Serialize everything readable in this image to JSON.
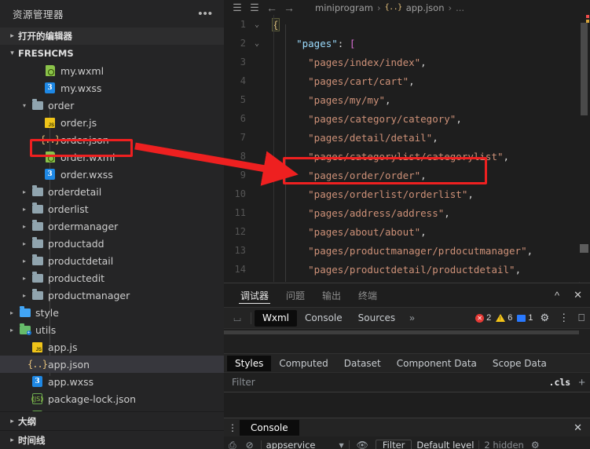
{
  "sidebar": {
    "title": "资源管理器",
    "more_icon": "ellipsis-icon",
    "open_editors": "打开的编辑器",
    "project": "FRESHCMS",
    "tree": [
      {
        "label": "my.wxml",
        "icon": "wxml-file-icon",
        "depth": 3,
        "twisty": "",
        "selected": false
      },
      {
        "label": "my.wxss",
        "icon": "wxss-file-icon",
        "depth": 3,
        "twisty": "",
        "selected": false
      },
      {
        "label": "order",
        "icon": "folder-open-icon",
        "depth": 2,
        "twisty": "▾",
        "selected": false
      },
      {
        "label": "order.js",
        "icon": "js-file-icon",
        "depth": 3,
        "twisty": "",
        "selected": false
      },
      {
        "label": "order.json",
        "icon": "json-file-icon",
        "depth": 3,
        "twisty": "",
        "selected": false
      },
      {
        "label": "order.wxml",
        "icon": "wxml-file-icon",
        "depth": 3,
        "twisty": "",
        "selected": false
      },
      {
        "label": "order.wxss",
        "icon": "wxss-file-icon",
        "depth": 3,
        "twisty": "",
        "selected": false
      },
      {
        "label": "orderdetail",
        "icon": "folder-icon",
        "depth": 2,
        "twisty": "▸",
        "selected": false
      },
      {
        "label": "orderlist",
        "icon": "folder-icon",
        "depth": 2,
        "twisty": "▸",
        "selected": false
      },
      {
        "label": "ordermanager",
        "icon": "folder-icon",
        "depth": 2,
        "twisty": "▸",
        "selected": false
      },
      {
        "label": "productadd",
        "icon": "folder-icon",
        "depth": 2,
        "twisty": "▸",
        "selected": false
      },
      {
        "label": "productdetail",
        "icon": "folder-icon",
        "depth": 2,
        "twisty": "▸",
        "selected": false
      },
      {
        "label": "productedit",
        "icon": "folder-icon",
        "depth": 2,
        "twisty": "▸",
        "selected": false
      },
      {
        "label": "productmanager",
        "icon": "folder-icon",
        "depth": 2,
        "twisty": "▸",
        "selected": false
      },
      {
        "label": "style",
        "icon": "folder-blue-icon",
        "depth": 1,
        "twisty": "▸",
        "selected": false
      },
      {
        "label": "utils",
        "icon": "folder-green-icon",
        "depth": 1,
        "twisty": "▸",
        "selected": false
      },
      {
        "label": "app.js",
        "icon": "js-file-icon",
        "depth": 2,
        "twisty": "",
        "selected": false
      },
      {
        "label": "app.json",
        "icon": "json-file-icon",
        "depth": 2,
        "twisty": "",
        "selected": true
      },
      {
        "label": "app.wxss",
        "icon": "wxss-file-icon",
        "depth": 2,
        "twisty": "",
        "selected": false
      },
      {
        "label": "package-lock.json",
        "icon": "node-file-icon",
        "depth": 2,
        "twisty": "",
        "selected": false
      },
      {
        "label": "package.json",
        "icon": "node-file-icon",
        "depth": 2,
        "twisty": "",
        "selected": false
      }
    ],
    "outline": "大纲",
    "timeline": "时间线"
  },
  "editor": {
    "toolbar_icons": [
      "list-icon",
      "bookmark-icon",
      "arrow-left-icon",
      "arrow-right-icon"
    ],
    "breadcrumb": {
      "root": "miniprogram",
      "file": "app.json",
      "tail": "...",
      "sep": "›"
    },
    "lines": [
      {
        "n": "1",
        "fold": "⌄",
        "html": "<span class=\"c-brace\">{</span>"
      },
      {
        "n": "2",
        "fold": "⌄",
        "html": "    <span class=\"c-key\">\"pages\"</span><span class=\"c-punct\">:</span> <span class=\"c-brk\">[</span>"
      },
      {
        "n": "3",
        "fold": "",
        "html": "      <span class=\"c-str\">\"pages/index/index\"</span><span class=\"c-punct\">,</span>"
      },
      {
        "n": "4",
        "fold": "",
        "html": "      <span class=\"c-str\">\"pages/cart/cart\"</span><span class=\"c-punct\">,</span>"
      },
      {
        "n": "5",
        "fold": "",
        "html": "      <span class=\"c-str\">\"pages/my/my\"</span><span class=\"c-punct\">,</span>"
      },
      {
        "n": "6",
        "fold": "",
        "html": "      <span class=\"c-str\">\"pages/category/category\"</span><span class=\"c-punct\">,</span>"
      },
      {
        "n": "7",
        "fold": "",
        "html": "      <span class=\"c-str\">\"pages/detail/detail\"</span><span class=\"c-punct\">,</span>"
      },
      {
        "n": "8",
        "fold": "",
        "html": "      <span class=\"c-str\">\"pages/categorylist/categorylist\"</span><span class=\"c-punct\">,</span>"
      },
      {
        "n": "9",
        "fold": "",
        "html": "      <span class=\"c-str\">\"pages/order/order\"</span><span class=\"c-punct\">,</span>"
      },
      {
        "n": "10",
        "fold": "",
        "html": "      <span class=\"c-str\">\"pages/orderlist/orderlist\"</span><span class=\"c-punct\">,</span>"
      },
      {
        "n": "11",
        "fold": "",
        "html": "      <span class=\"c-str\">\"pages/address/address\"</span><span class=\"c-punct\">,</span>"
      },
      {
        "n": "12",
        "fold": "",
        "html": "      <span class=\"c-str\">\"pages/about/about\"</span><span class=\"c-punct\">,</span>"
      },
      {
        "n": "13",
        "fold": "",
        "html": "      <span class=\"c-str\">\"pages/productmanager/prdocutmanager\"</span><span class=\"c-punct\">,</span>"
      },
      {
        "n": "14",
        "fold": "",
        "html": "      <span class=\"c-str\">\"pages/productdetail/productdetail\"</span><span class=\"c-punct\">,</span>"
      }
    ]
  },
  "panel": {
    "tabs": [
      {
        "label": "调试器",
        "active": true
      },
      {
        "label": "问题",
        "active": false
      },
      {
        "label": "输出",
        "active": false
      },
      {
        "label": "终端",
        "active": false
      }
    ],
    "collapse_icon": "chevron-up-icon",
    "close_icon": "close-icon",
    "devtools": {
      "inspect_icon": "inspect-element-icon",
      "tabs": [
        {
          "label": "Wxml",
          "active": true
        },
        {
          "label": "Console",
          "active": false
        },
        {
          "label": "Sources",
          "active": false
        }
      ],
      "overflow": "»",
      "errors": "2",
      "warnings": "6",
      "infos": "1",
      "settings_icon": "gear-icon",
      "kebab_icon": "kebab-menu-icon",
      "dock_icon": "dock-panel-icon"
    },
    "styles": {
      "tabs": [
        {
          "label": "Styles",
          "active": true
        },
        {
          "label": "Computed",
          "active": false
        },
        {
          "label": "Dataset",
          "active": false
        },
        {
          "label": "Component Data",
          "active": false
        },
        {
          "label": "Scope Data",
          "active": false
        }
      ],
      "filter_placeholder": "Filter",
      "cls_label": ".cls",
      "plus_icon": "plus-icon"
    },
    "console": {
      "kebab_icon": "kebab-menu-icon",
      "tab_label": "Console",
      "close_icon": "close-icon",
      "sidebar_icon": "console-sidebar-icon",
      "clear_icon": "clear-console-icon",
      "context": "appservice",
      "caret_icon": "chevron-down-icon",
      "eye_icon": "eye-icon",
      "filter_label": "Filter",
      "level_label": "Default level",
      "hidden_label": "2 hidden",
      "settings_icon": "console-settings-icon"
    }
  },
  "annotations": {
    "color": "#ee2020",
    "box_file": "order.wxml",
    "box_code": "pages/order/order",
    "arrow": "red-arrow"
  }
}
